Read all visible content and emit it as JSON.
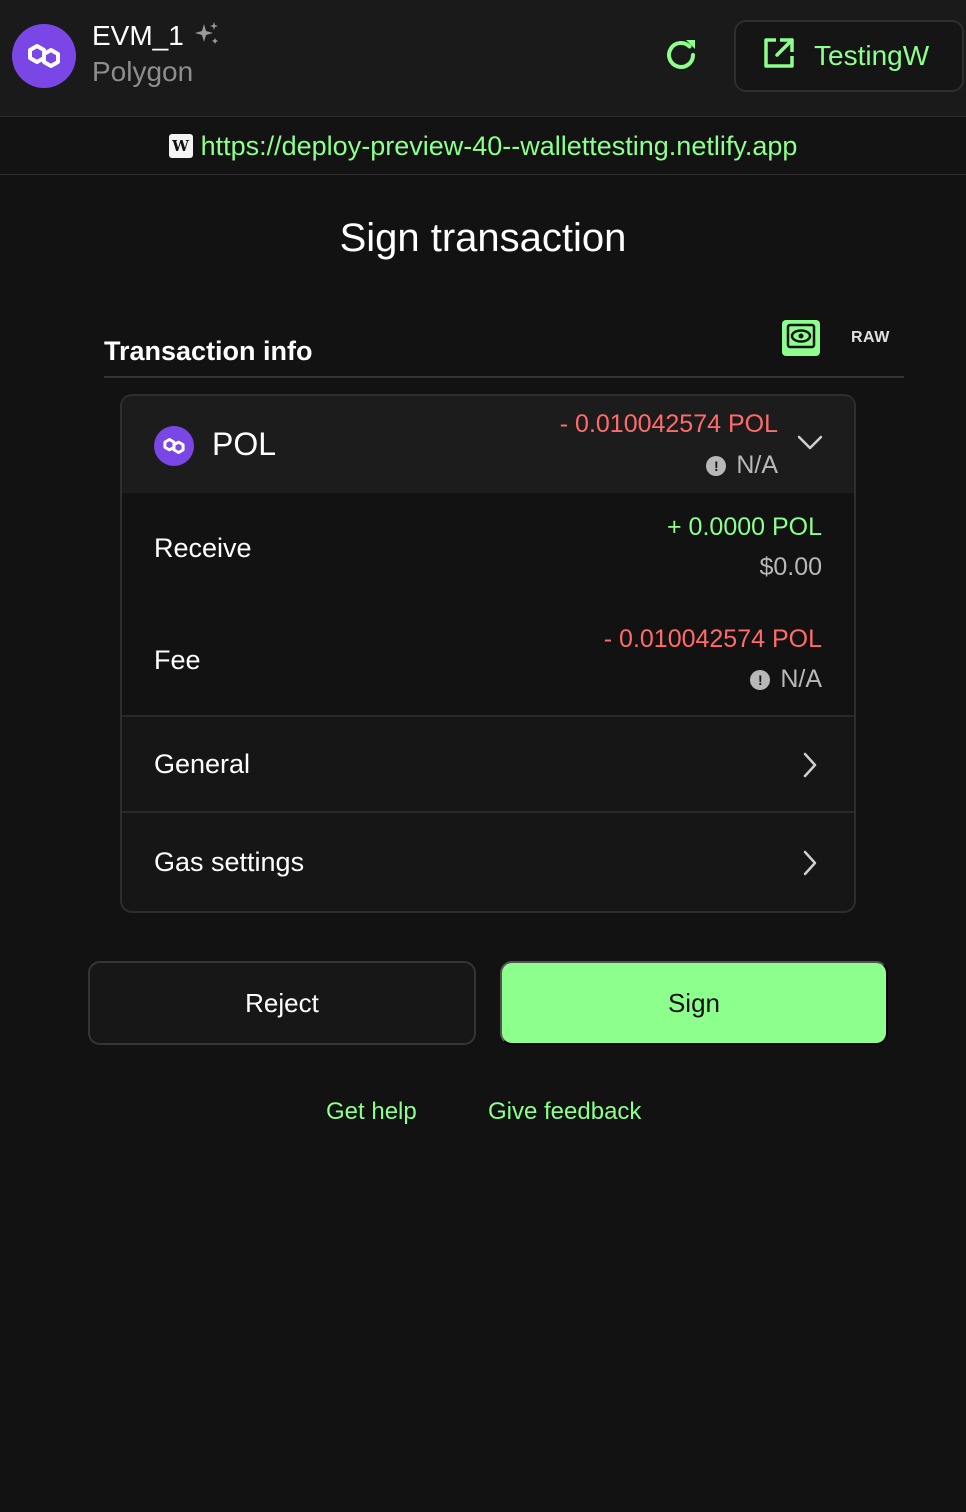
{
  "header": {
    "account_name": "EVM_1",
    "network": "Polygon",
    "wallet_button_label": "TestingW"
  },
  "url": "https://deploy-preview-40--wallettesting.netlify.app",
  "site_icon_letter": "W",
  "title": "Sign transaction",
  "tx_info": {
    "label": "Transaction info",
    "raw_label": "RAW"
  },
  "asset": {
    "name": "POL",
    "amount": "- 0.010042574 POL",
    "usd": "N/A"
  },
  "receive": {
    "label": "Receive",
    "amount": "+ 0.0000 POL",
    "usd": "$0.00"
  },
  "fee": {
    "label": "Fee",
    "amount": "- 0.010042574 POL",
    "usd": "N/A"
  },
  "sections": {
    "general": "General",
    "gas": "Gas settings"
  },
  "actions": {
    "reject": "Reject",
    "sign": "Sign"
  },
  "links": {
    "help": "Get help",
    "feedback": "Give feedback"
  },
  "icons": {
    "account_avatar": "polygon-logo-icon",
    "sparkle": "sparkle-icon",
    "refresh": "refresh-icon",
    "external": "external-link-icon",
    "eye": "eye-icon",
    "warning": "warning-icon",
    "chevron_down": "chevron-down-icon",
    "chevron_right": "chevron-right-icon"
  },
  "colors": {
    "accent": "#8cff8c",
    "negative": "#ff6b6b",
    "polygon": "#7b46e6",
    "background": "#121212"
  }
}
